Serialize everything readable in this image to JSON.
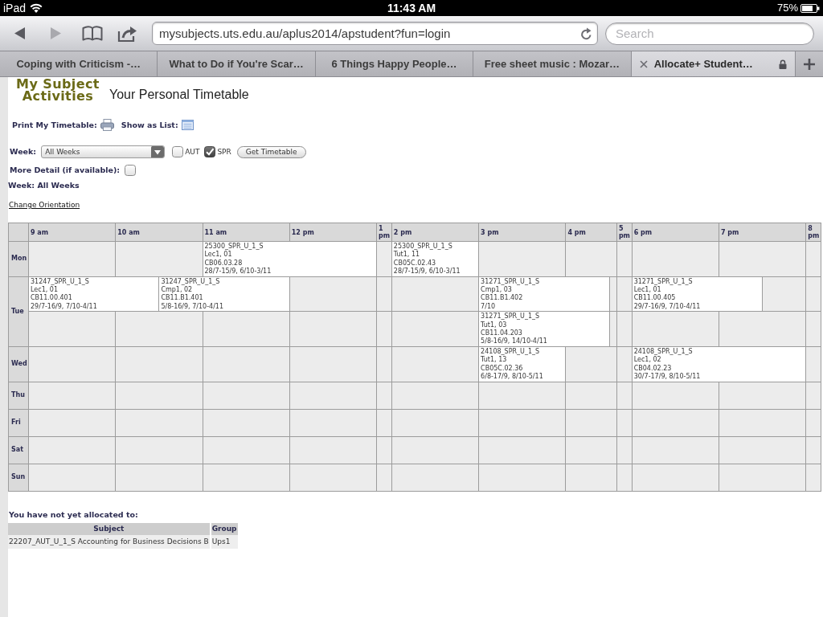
{
  "status_bar": {
    "device": "iPad",
    "time": "11:43 AM",
    "battery": "75%"
  },
  "toolbar": {
    "nav": [
      {
        "kind": "back",
        "disabled": false
      },
      {
        "kind": "forward",
        "disabled": true
      }
    ],
    "url": "mysubjects.uts.edu.au/aplus2014/apstudent?fun=login",
    "search": {
      "placeholder": "Search"
    }
  },
  "tabs": [
    {
      "label": "Coping with Criticism -…",
      "selected": false
    },
    {
      "label": "What to Do if You're Scar…",
      "selected": false
    },
    {
      "label": "6 Things Happy People…",
      "selected": false
    },
    {
      "label": "Free sheet music : Mozar…",
      "selected": false
    },
    {
      "label": "Allocate+ Student…",
      "selected": true
    }
  ],
  "page": {
    "logo": "My Subject Activities",
    "title": "Your Personal Timetable",
    "actions": [
      {
        "kind": "print",
        "label": "Print My Timetable:"
      },
      {
        "kind": "list",
        "label": "Show as List:"
      }
    ],
    "week_filter": {
      "label": "Week:",
      "value": "All Weeks",
      "semesters": [
        {
          "label": "AUT",
          "checked": false
        },
        {
          "label": "SPR",
          "checked": true
        }
      ],
      "button": "Get Timetable"
    },
    "more_detail": {
      "label": "More Detail (if available):",
      "checked": false
    },
    "current_week": "Week: All Weeks",
    "change_orientation": "Change Orientation",
    "timetable": {
      "hours": [
        "9 am",
        "10 am",
        "11 am",
        "12 pm",
        "1 pm",
        "2 pm",
        "3 pm",
        "4 pm",
        "5 pm",
        "6 pm",
        "7 pm",
        "8 pm"
      ],
      "days": [
        {
          "label": "Mon",
          "tracks": [
            [
              {
                "kind": "hour"
              },
              {
                "kind": "hour"
              },
              {
                "kind": "event120",
                "code": "25300_SPR_U_1_S",
                "activity": "Lec1, 01",
                "room": "CB06.03.28",
                "weeks": "28/7-15/9, 6/10-3/11"
              },
              {
                "kind": "hour"
              },
              {
                "kind": "event60",
                "code": "25300_SPR_U_1_S",
                "activity": "Tut1, 11",
                "room": "CB05C.02.43",
                "weeks": "28/7-15/9, 6/10-3/11"
              },
              {
                "kind": "hour"
              },
              {
                "kind": "hour"
              },
              {
                "kind": "hour"
              },
              {
                "kind": "hour"
              },
              {
                "kind": "hour"
              },
              {
                "kind": "hour"
              }
            ]
          ]
        },
        {
          "label": "Tue",
          "tracks": [
            [
              {
                "kind": "event90",
                "code": "31247_SPR_U_1_S",
                "activity": "Lec1, 01",
                "room": "CB11.00.401",
                "weeks": "29/7-16/9, 7/10-4/11"
              },
              {
                "kind": "event90",
                "code": "31247_SPR_U_1_S",
                "activity": "Cmp1, 02",
                "room": "CB11.B1.401",
                "weeks": "5/8-16/9, 7/10-4/11"
              },
              {
                "kind": "hour"
              },
              {
                "kind": "hour"
              },
              {
                "kind": "hour"
              },
              {
                "kind": "event90",
                "code": "31271_SPR_U_1_S",
                "activity": "Cmp1, 03",
                "room": "CB11.B1.402",
                "weeks": "7/10"
              },
              {
                "kind": "halfhour"
              },
              {
                "kind": "hour"
              },
              {
                "kind": "event90",
                "code": "31271_SPR_U_1_S",
                "activity": "Lec1, 01",
                "room": "CB11.00.405",
                "weeks": "29/7-16/9, 7/10-4/11"
              },
              {
                "kind": "halfhour"
              },
              {
                "kind": "hour"
              }
            ],
            [
              {
                "kind": "hour"
              },
              {
                "kind": "hour"
              },
              {
                "kind": "hour"
              },
              {
                "kind": "hour"
              },
              {
                "kind": "hour"
              },
              {
                "kind": "hour"
              },
              {
                "kind": "event90",
                "code": "31271_SPR_U_1_S",
                "activity": "Tut1, 03",
                "room": "CB11.04.203",
                "weeks": "5/8-16/9, 14/10-4/11"
              },
              {
                "kind": "halfhour"
              },
              {
                "kind": "hour"
              },
              {
                "kind": "hour"
              },
              {
                "kind": "hour"
              },
              {
                "kind": "hour"
              }
            ]
          ]
        },
        {
          "label": "Wed",
          "tracks": [
            [
              {
                "kind": "hour"
              },
              {
                "kind": "hour"
              },
              {
                "kind": "hour"
              },
              {
                "kind": "hour"
              },
              {
                "kind": "hour"
              },
              {
                "kind": "hour"
              },
              {
                "kind": "event60",
                "code": "24108_SPR_U_1_S",
                "activity": "Tut1, 13",
                "room": "CB05C.02.36",
                "weeks": "6/8-17/9, 8/10-5/11"
              },
              {
                "kind": "hour"
              },
              {
                "kind": "hour"
              },
              {
                "kind": "event120",
                "code": "24108_SPR_U_1_S",
                "activity": "Lec1, 02",
                "room": "CB04.02.23",
                "weeks": "30/7-17/9, 8/10-5/11"
              },
              {
                "kind": "hour"
              }
            ]
          ]
        },
        {
          "label": "Thu"
        },
        {
          "label": "Fri"
        },
        {
          "label": "Sat"
        },
        {
          "label": "Sun"
        }
      ]
    },
    "unallocated": {
      "title": "You have not yet allocated to:",
      "columns": [
        "Subject",
        "Group"
      ],
      "rows": [
        [
          "22207_AUT_U_1_S Accounting for Business Decisions B",
          "Ups1"
        ]
      ]
    }
  }
}
